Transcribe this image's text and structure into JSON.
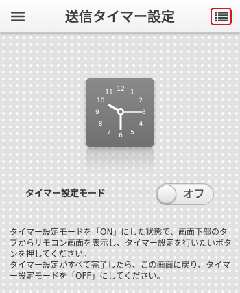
{
  "header": {
    "title": "送信タイマー設定",
    "menu_icon": "hamburger-menu-icon",
    "list_icon": "list-icon",
    "highlight_color": "#d6171e"
  },
  "clock": {
    "icon": "clock-icon",
    "numbers": [
      "12",
      "1",
      "2",
      "3",
      "4",
      "5",
      "6",
      "7",
      "8",
      "9",
      "10",
      "11"
    ],
    "hour_hand": "10",
    "minute_hand": "6",
    "second_hand": "3"
  },
  "timer_mode": {
    "label": "タイマー設定モード",
    "toggle_text": "オフ",
    "state": "off"
  },
  "description": {
    "paragraph1": "タイマー設定モードを「ON」にした状態で、画面下部のタブからリモコン画面を表示し、タイマー設定を行いたいボタンを押してください。",
    "paragraph2": "タイマー設定がすべて完了したら、この画面に戻り、タイマー設定モードを「OFF」にしてください。"
  }
}
